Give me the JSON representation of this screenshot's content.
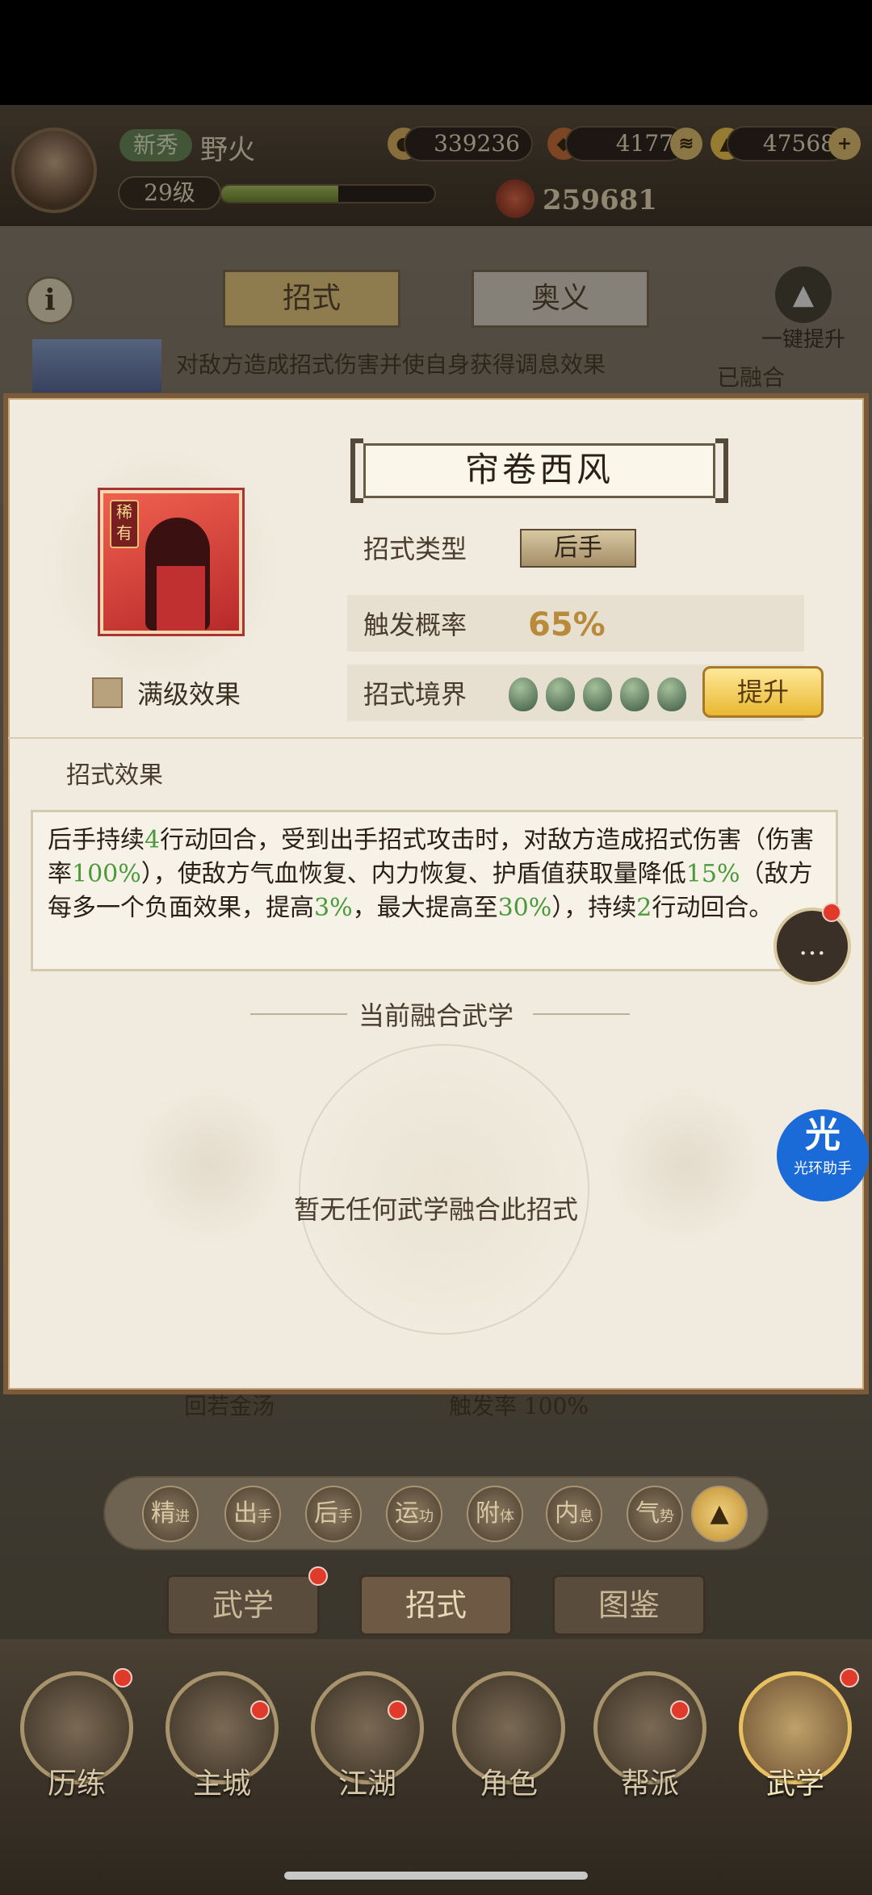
{
  "player": {
    "badge": "新秀",
    "name": "野火",
    "level": "29级",
    "exp_progress": 0.55,
    "coins": "339236",
    "resource2": "4177",
    "gold": "47568",
    "power": "259681",
    "gold_add": "+"
  },
  "behind": {
    "tab_active": "招式",
    "tab_inactive": "奥义",
    "info": "i",
    "upgrade_all": "一键提升",
    "row_text": "对敌方造成招式伤害并使自身获得调息效果",
    "row_status": "已融合",
    "row2_text": "回若金汤",
    "row2_rate": "触发率 100%"
  },
  "skill": {
    "title": "帘卷西风",
    "rare_tag": "稀有",
    "max_effect_label": "满级效果",
    "type_label": "招式类型",
    "type_value": "后手",
    "rate_label": "触发概率",
    "rate_value": "65%",
    "realm_label": "招式境界",
    "upgrade_btn": "提升",
    "effect_section": "招式效果",
    "fusion_title": "当前融合武学",
    "fusion_empty": "暂无任何武学融合此招式"
  },
  "effect_parts": [
    {
      "t": "后手持续",
      "g": false
    },
    {
      "t": "4",
      "g": true
    },
    {
      "t": "行动回合，受到出手招式攻击时，对敌方造成招式伤害（伤害率",
      "g": false
    },
    {
      "t": "100%",
      "g": true
    },
    {
      "t": "），使敌方气血恢复、内力恢复、护盾值获取量降低",
      "g": false
    },
    {
      "t": "15%",
      "g": true
    },
    {
      "t": "（敌方每多一个负面效果，提高",
      "g": false
    },
    {
      "t": "3%",
      "g": true
    },
    {
      "t": "，最大提高至",
      "g": false
    },
    {
      "t": "30%",
      "g": true
    },
    {
      "t": "），持续",
      "g": false
    },
    {
      "t": "2",
      "g": true
    },
    {
      "t": "行动回合。",
      "g": false
    }
  ],
  "filters": [
    {
      "main": "精",
      "sub": "进"
    },
    {
      "main": "出",
      "sub": "手"
    },
    {
      "main": "后",
      "sub": "手"
    },
    {
      "main": "运",
      "sub": "功"
    },
    {
      "main": "附",
      "sub": "体"
    },
    {
      "main": "内",
      "sub": "息"
    },
    {
      "main": "气",
      "sub": "势"
    }
  ],
  "filter_up": "▲",
  "subtabs": {
    "a": "武学",
    "b": "招式",
    "c": "图鉴"
  },
  "nav": {
    "n1": "历练",
    "n2": "主城",
    "n3": "江湖",
    "n4": "角色",
    "n5": "帮派",
    "n6": "武学"
  },
  "chat_icon": "…",
  "helper": {
    "big": "光",
    "small": "光环助手"
  },
  "icons": {
    "realm": "gourd-icon",
    "chat": "chat-bubble-icon",
    "coin": "coin-icon"
  },
  "colors": {
    "accent": "#4a9a3a",
    "frame": "#7a5a3a",
    "button_gold": "#e8b830"
  }
}
